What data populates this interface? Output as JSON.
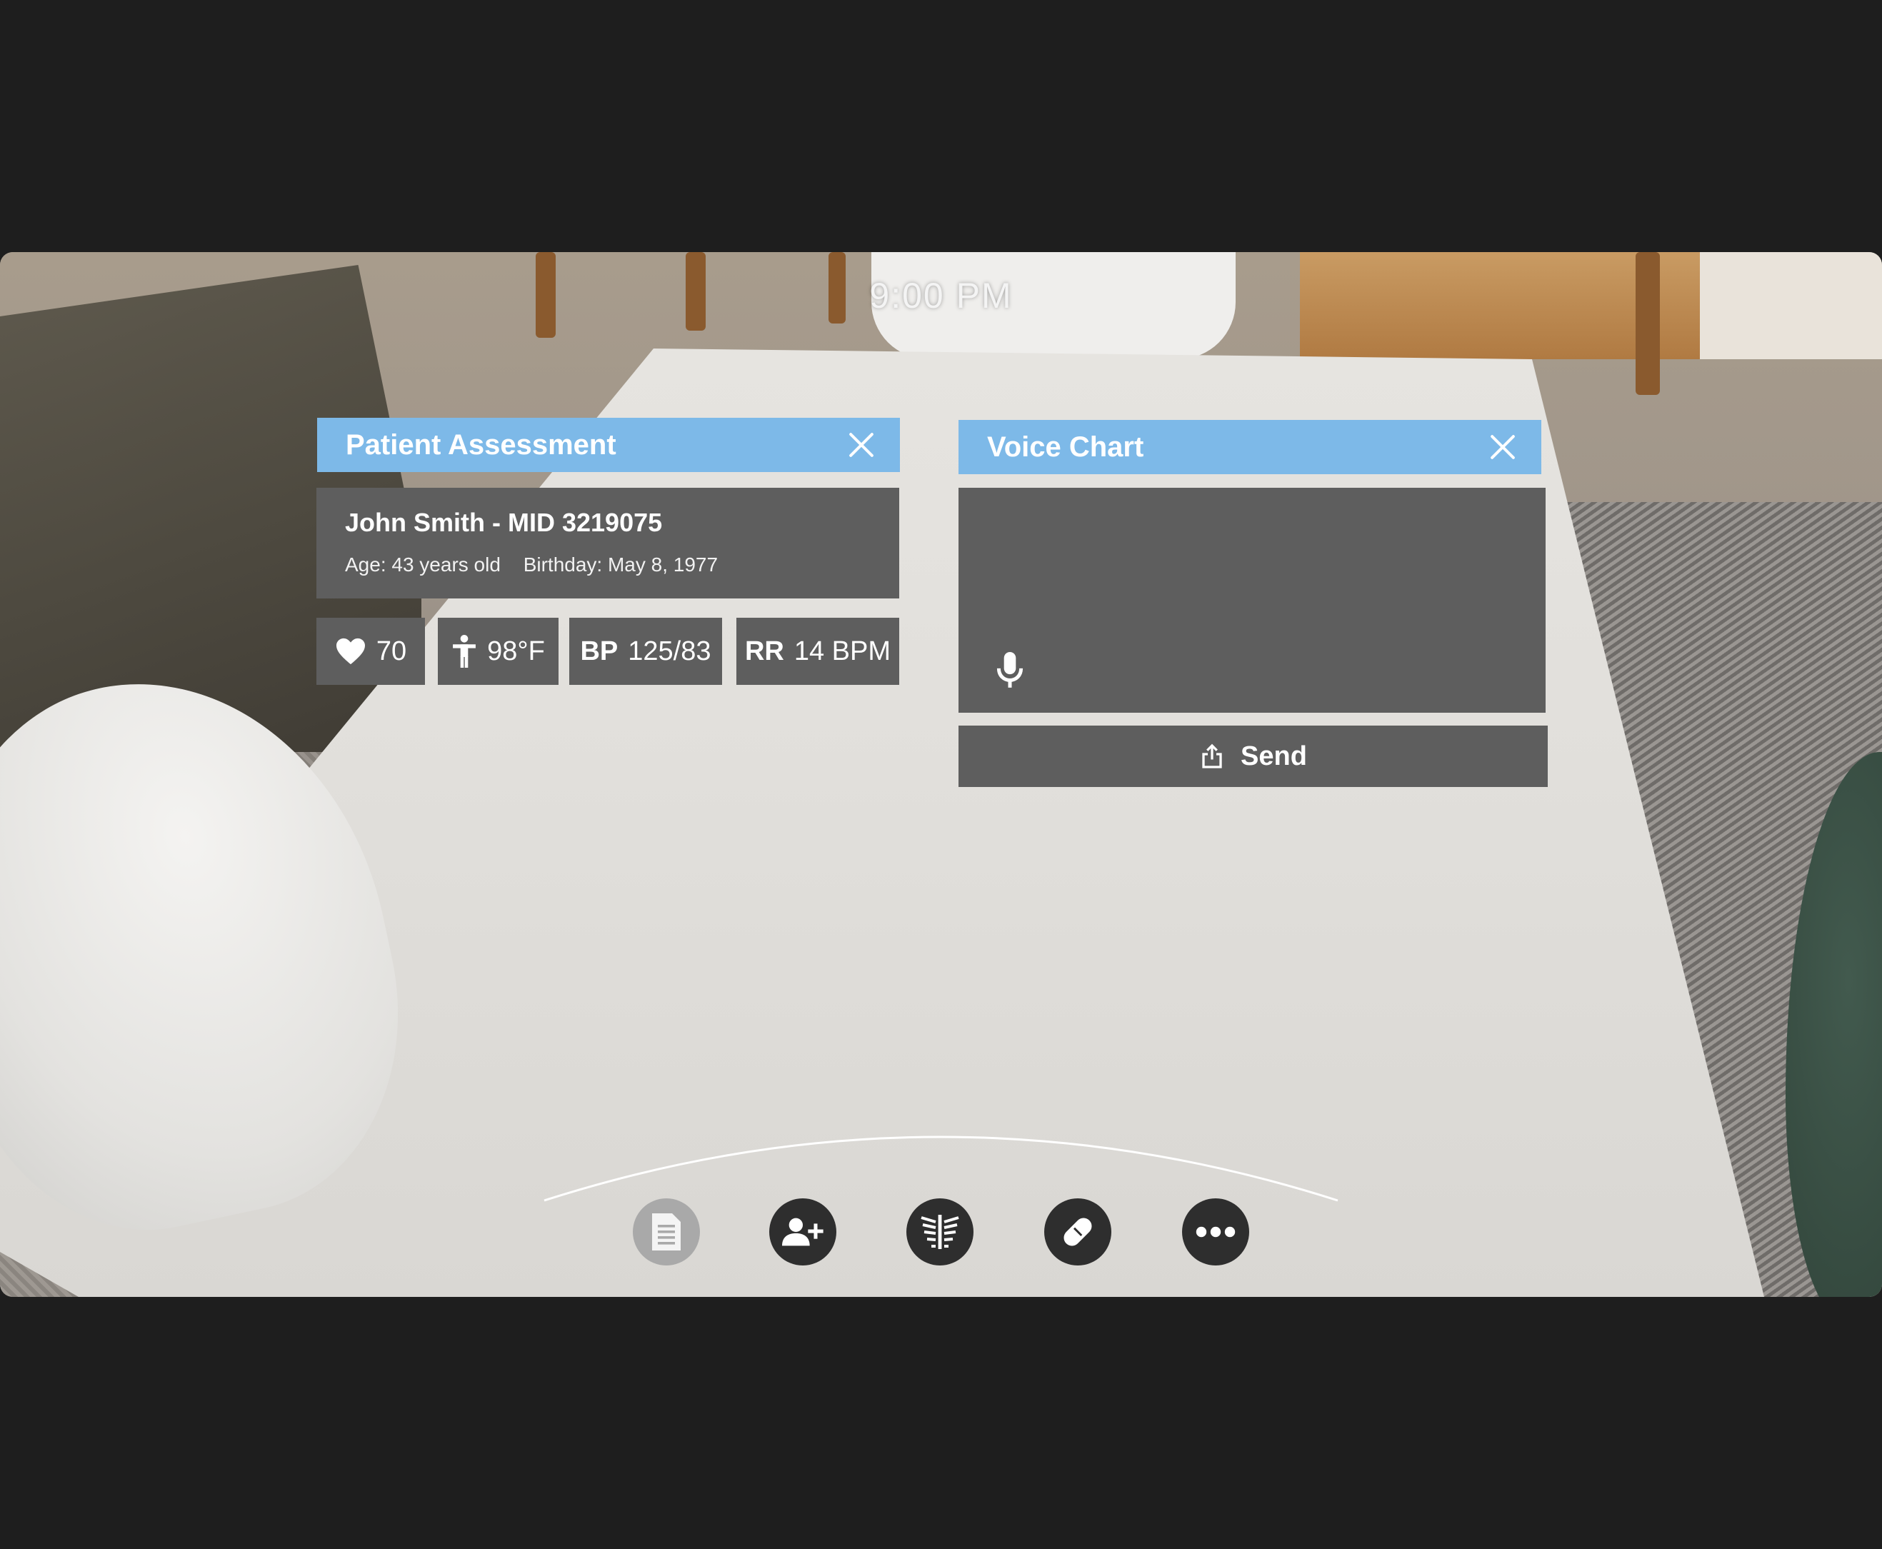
{
  "status": {
    "time": "9:00 PM"
  },
  "patient_assessment": {
    "title": "Patient Assessment",
    "name_line": "John Smith - MID 3219075",
    "age": "Age: 43 years old",
    "birthday": "Birthday: May 8, 1977",
    "vitals": {
      "heart_rate": {
        "icon": "heart-icon",
        "value": "70"
      },
      "temperature": {
        "icon": "person-icon",
        "value": "98°F"
      },
      "blood_pressure": {
        "label": "BP",
        "value": "125/83"
      },
      "respiratory_rate": {
        "label": "RR",
        "value": "14 BPM"
      }
    }
  },
  "voice_chart": {
    "title": "Voice Chart",
    "send_label": "Send"
  },
  "dock": [
    {
      "icon": "document-icon",
      "active": true
    },
    {
      "icon": "add-person-icon",
      "active": false
    },
    {
      "icon": "lungs-icon",
      "active": false
    },
    {
      "icon": "pill-icon",
      "active": false
    },
    {
      "icon": "more-icon",
      "active": false
    }
  ],
  "colors": {
    "header_blue": "#7db9e8",
    "panel_gray": "#5e5e5e",
    "dock_dark": "#2e2e2e",
    "dock_active": "#a9a9a9",
    "frame": "#1e1e1e"
  }
}
